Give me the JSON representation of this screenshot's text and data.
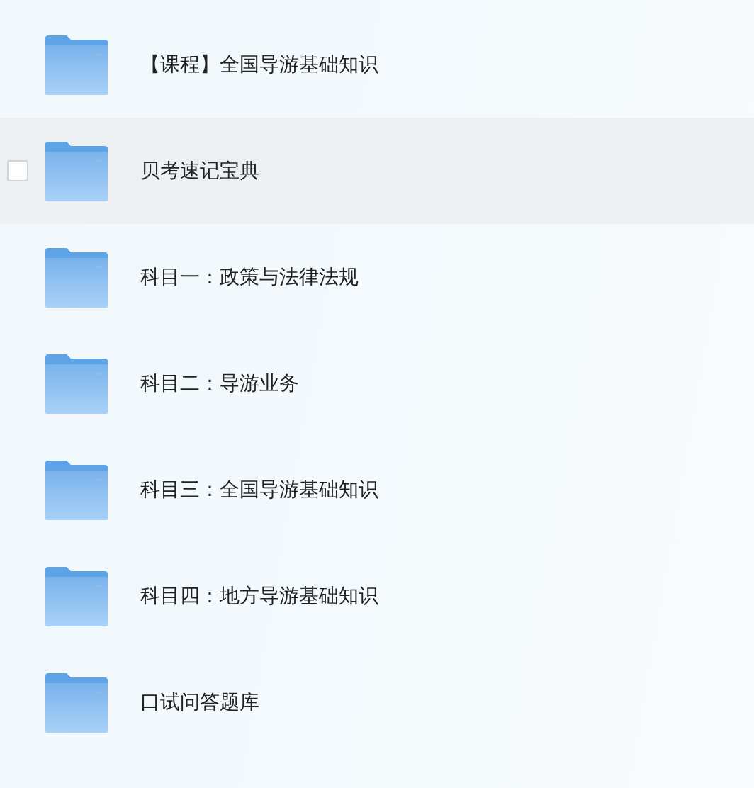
{
  "folders": [
    {
      "name": "【课程】全国导游基础知识",
      "highlighted": false,
      "checked": false
    },
    {
      "name": "贝考速记宝典",
      "highlighted": true,
      "checked": false
    },
    {
      "name": "科目一：政策与法律法规",
      "highlighted": false,
      "checked": false
    },
    {
      "name": "科目二：导游业务",
      "highlighted": false,
      "checked": false
    },
    {
      "name": "科目三：全国导游基础知识",
      "highlighted": false,
      "checked": false
    },
    {
      "name": "科目四：地方导游基础知识",
      "highlighted": false,
      "checked": false
    },
    {
      "name": "口试问答题库",
      "highlighted": false,
      "checked": false
    }
  ]
}
